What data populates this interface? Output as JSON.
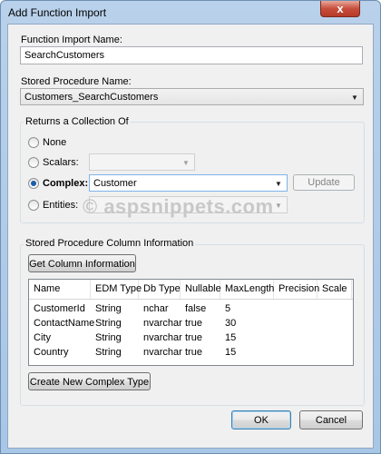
{
  "window": {
    "title": "Add Function Import",
    "close_glyph": "x"
  },
  "function_import": {
    "label": "Function Import Name:",
    "value": "SearchCustomers"
  },
  "stored_procedure": {
    "label": "Stored Procedure Name:",
    "selected": "Customers_SearchCustomers"
  },
  "returns": {
    "title": "Returns a Collection Of",
    "options": [
      {
        "label": "None",
        "checked": false
      },
      {
        "label": "Scalars:",
        "checked": false
      },
      {
        "label": "Complex:",
        "checked": true
      },
      {
        "label": "Entities:",
        "checked": false
      }
    ],
    "scalars_value": "",
    "complex_value": "Customer",
    "entities_value": "",
    "update_label": "Update"
  },
  "watermark": "© aspsnippets.com",
  "column_info": {
    "title": "Stored Procedure Column Information",
    "get_button": "Get Column Information",
    "headers": [
      "Name",
      "EDM Type",
      "Db Type",
      "Nullable",
      "MaxLength",
      "Precision",
      "Scale"
    ],
    "rows": [
      [
        "CustomerId",
        "String",
        "nchar",
        "false",
        "5",
        "",
        ""
      ],
      [
        "ContactName",
        "String",
        "nvarchar",
        "true",
        "30",
        "",
        ""
      ],
      [
        "City",
        "String",
        "nvarchar",
        "true",
        "15",
        "",
        ""
      ],
      [
        "Country",
        "String",
        "nvarchar",
        "true",
        "15",
        "",
        ""
      ]
    ],
    "create_button": "Create New Complex Type"
  },
  "footer": {
    "ok": "OK",
    "cancel": "Cancel"
  }
}
